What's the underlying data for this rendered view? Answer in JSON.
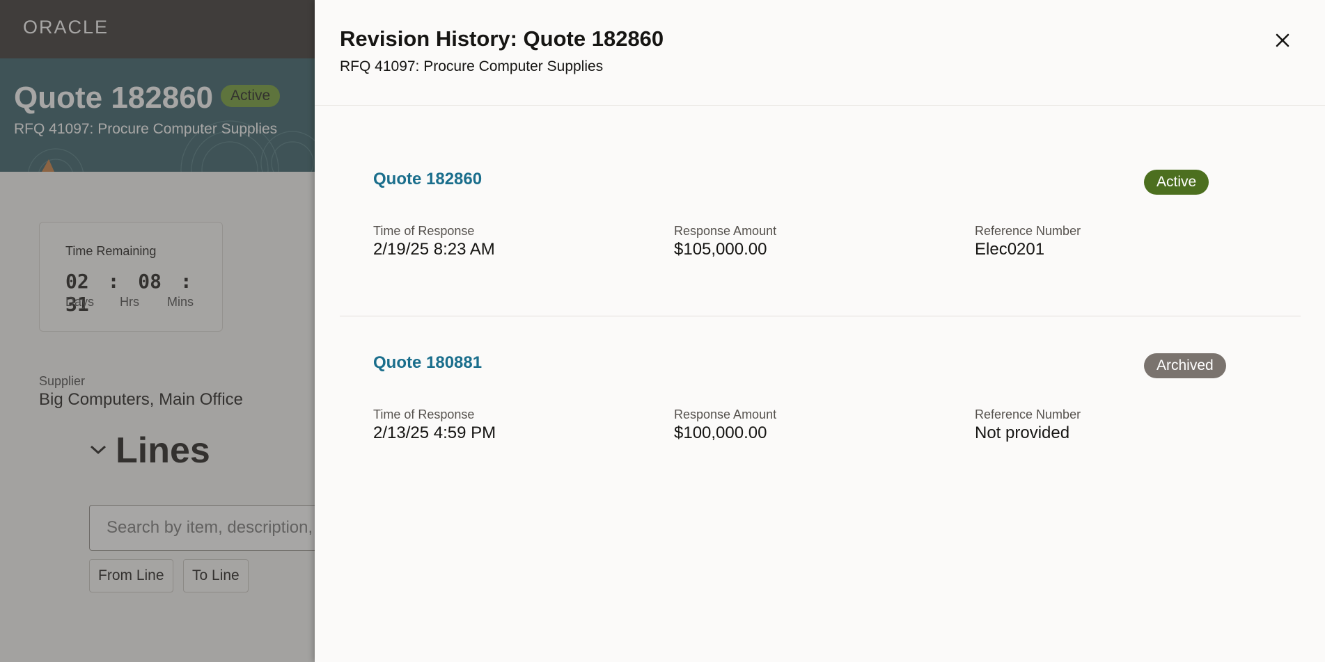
{
  "app": {
    "logo": "ORACLE"
  },
  "hero": {
    "title": "Quote 182860",
    "status": "Active",
    "subtitle": "RFQ 41097: Procure Computer Supplies"
  },
  "timer": {
    "label": "Time Remaining",
    "days": "02",
    "hours": "08",
    "mins": "31",
    "sep": ":",
    "days_label": "Days",
    "hours_label": "Hrs",
    "mins_label": "Mins"
  },
  "supplier": {
    "label": "Supplier",
    "value": "Big Computers, Main Office"
  },
  "lines": {
    "title": "Lines",
    "search_placeholder": "Search by item, description, or category",
    "from_line": "From Line",
    "to_line": "To Line"
  },
  "drawer": {
    "title": "Revision History: Quote 182860",
    "subtitle": "RFQ 41097: Procure Computer Supplies",
    "close_label": "Close",
    "revisions": [
      {
        "name": "Quote 182860",
        "status": "Active",
        "time_label": "Time of Response",
        "time_value": "2/19/25 8:23 AM",
        "amount_label": "Response Amount",
        "amount_value": "$105,000.00",
        "ref_label": "Reference Number",
        "ref_value": "Elec0201"
      },
      {
        "name": "Quote 180881",
        "status": "Archived",
        "time_label": "Time of Response",
        "time_value": "2/13/25 4:59 PM",
        "amount_label": "Response Amount",
        "amount_value": "$100,000.00",
        "ref_label": "Reference Number",
        "ref_value": "Not provided"
      }
    ]
  },
  "colors": {
    "topbar": "#312d2a",
    "hero": "#2f5962",
    "link": "#1a6e8c",
    "active_badge": "#4c6f1f",
    "archived_badge": "#7a736e"
  }
}
